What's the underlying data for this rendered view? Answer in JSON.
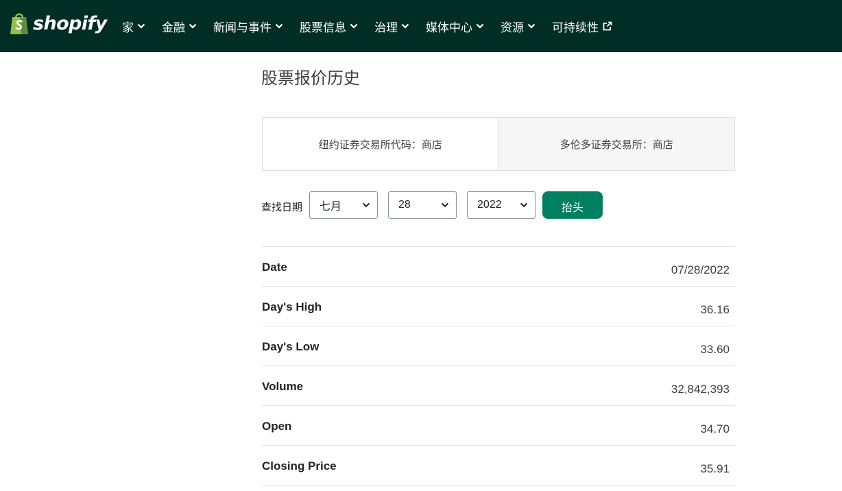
{
  "brand": {
    "name": "shopify",
    "logo_icon": "shopping-bag-icon",
    "accent": "#95bf47"
  },
  "colors": {
    "header_bg": "#002e25",
    "button_bg": "#008060"
  },
  "nav": [
    {
      "label": "家",
      "icon": "chevron-down-icon"
    },
    {
      "label": "金融",
      "icon": "chevron-down-icon"
    },
    {
      "label": "新闻与事件",
      "icon": "chevron-down-icon"
    },
    {
      "label": "股票信息",
      "icon": "chevron-down-icon"
    },
    {
      "label": "治理",
      "icon": "chevron-down-icon"
    },
    {
      "label": "媒体中心",
      "icon": "chevron-down-icon"
    },
    {
      "label": "资源",
      "icon": "chevron-down-icon"
    },
    {
      "label": "可持续性",
      "icon": "external-link-icon"
    }
  ],
  "page": {
    "title": "股票报价历史"
  },
  "exchanges": [
    {
      "label": "纽约证券交易所代码：商店",
      "selected": true
    },
    {
      "label": "多伦多证券交易所：商店",
      "selected": false
    }
  ],
  "lookup": {
    "label": "查找日期",
    "month": "七月",
    "day": "28",
    "year": "2022",
    "button": "抬头"
  },
  "quote": [
    {
      "label": "Date",
      "value": "07/28/2022"
    },
    {
      "label": "Day's High",
      "value": "36.16"
    },
    {
      "label": "Day's Low",
      "value": "33.60"
    },
    {
      "label": "Volume",
      "value": "32,842,393"
    },
    {
      "label": "Open",
      "value": "34.70"
    },
    {
      "label": "Closing Price",
      "value": "35.91"
    }
  ]
}
